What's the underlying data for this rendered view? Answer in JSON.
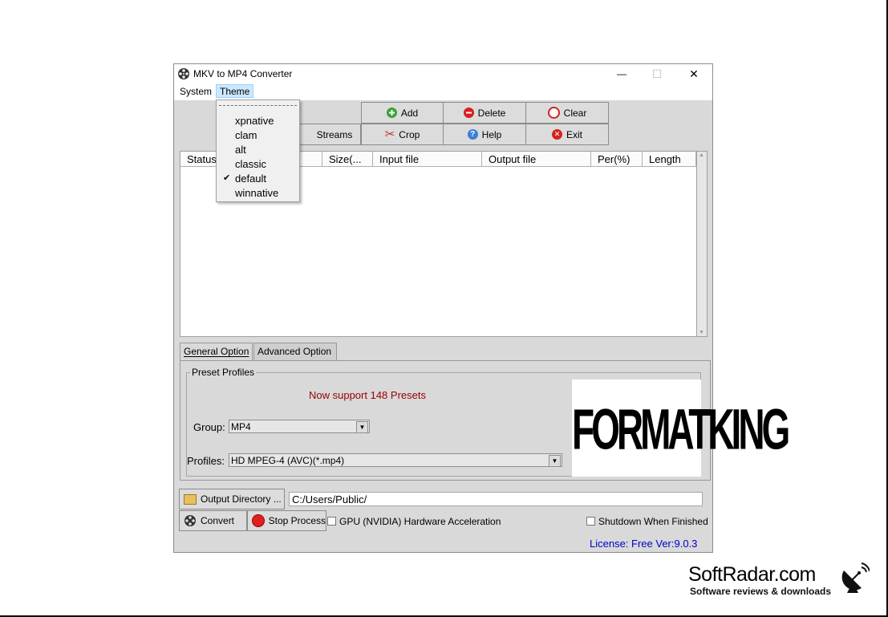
{
  "window": {
    "title": "MKV to MP4 Converter",
    "controls": {
      "minimize": "—",
      "maximize": "☐",
      "close": "✕"
    }
  },
  "menubar": {
    "system": "System",
    "theme": "Theme"
  },
  "theme_menu": {
    "items": [
      "xpnative",
      "clam",
      "alt",
      "classic",
      "default",
      "winnative"
    ],
    "checked": "default",
    "check_glyph": "✔"
  },
  "toolbar": {
    "streams": "Streams",
    "add": "Add",
    "delete": "Delete",
    "clear": "Clear",
    "crop": "Crop",
    "help": "Help",
    "exit": "Exit"
  },
  "file_list": {
    "columns": [
      "Status",
      "Size(...",
      "Input file",
      "Output file",
      "Per(%)",
      "Length"
    ],
    "rows": []
  },
  "tabs": {
    "general": "General Option",
    "advanced": "Advanced Option",
    "active": "general"
  },
  "preset": {
    "group_title": "Preset Profiles",
    "support_text": "Now support 148 Presets",
    "group_label": "Group:",
    "group_value": "MP4",
    "profiles_label": "Profiles:",
    "profiles_value": "HD MPEG-4 (AVC)(*.mp4)"
  },
  "logo": {
    "text": "FORMATKING"
  },
  "output": {
    "button": "Output Directory ...",
    "path": "C:/Users/Public/"
  },
  "actions": {
    "convert": "Convert",
    "stop": "Stop Process",
    "gpu": "GPU (NVIDIA) Hardware Acceleration",
    "gpu_checked": false,
    "shutdown": "Shutdown When Finished",
    "shutdown_checked": false
  },
  "license": "License: Free Ver:9.0.3",
  "watermark": {
    "brand": "SoftRadar.com",
    "tagline": "Software reviews & downloads"
  },
  "colors": {
    "support_text": "#990000",
    "license_text": "#0000cc",
    "menu_highlight": "#cce8ff",
    "window_bg": "#d9d9d9"
  }
}
